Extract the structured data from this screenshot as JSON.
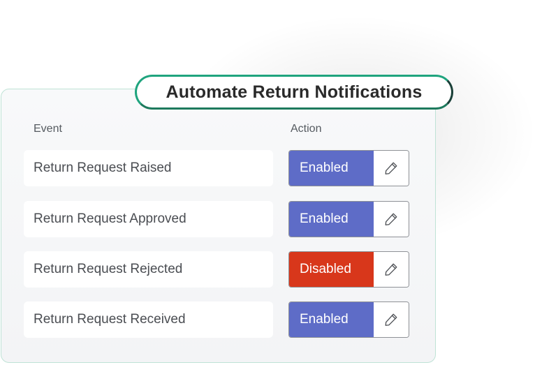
{
  "card": {
    "title": "Automate Return Notifications",
    "headers": {
      "event": "Event",
      "action": "Action"
    },
    "rows": [
      {
        "event": "Return Request Raised",
        "status": "Enabled",
        "status_color": "#5e6cc7"
      },
      {
        "event": "Return Request Approved",
        "status": "Enabled",
        "status_color": "#5e6cc7"
      },
      {
        "event": "Return Request Rejected",
        "status": "Disabled",
        "status_color": "#d8371b"
      },
      {
        "event": "Return Request Received",
        "status": "Enabled",
        "status_color": "#5e6cc7"
      }
    ],
    "edit_icon": "pencil-icon"
  },
  "colors": {
    "enabled": "#5e6cc7",
    "disabled": "#d8371b",
    "accent_border": "#1fa47e"
  }
}
